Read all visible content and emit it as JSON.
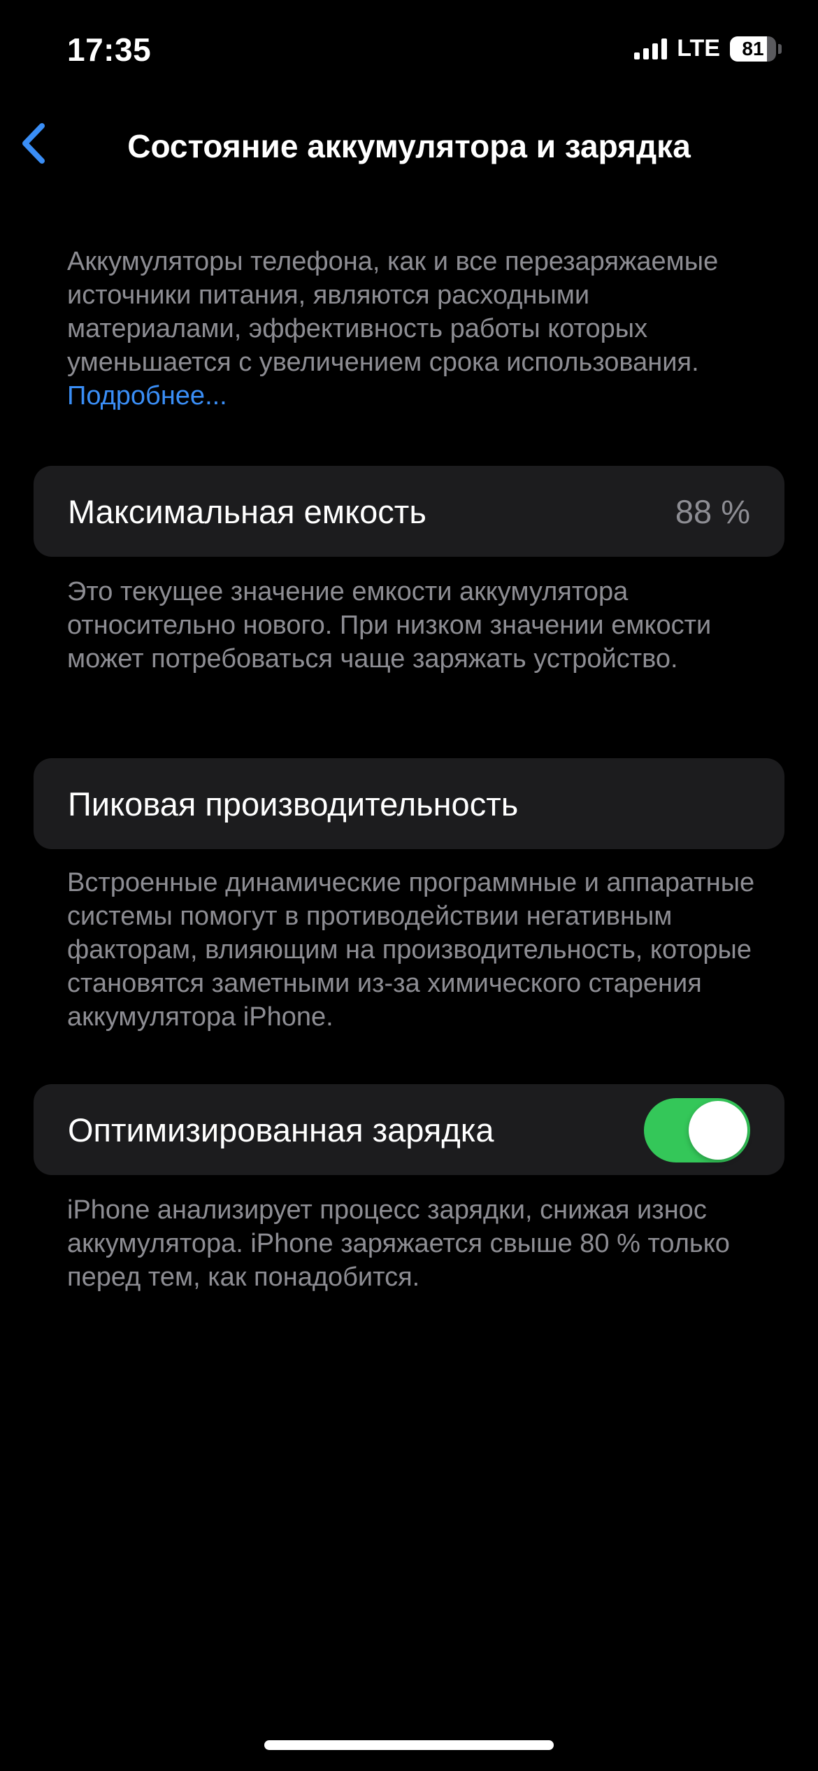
{
  "status_bar": {
    "time": "17:35",
    "network": "LTE",
    "battery_percent": "81",
    "battery_level": 0.81
  },
  "nav": {
    "back_icon": "chevron-left-icon",
    "title": "Состояние аккумулятора и зарядка"
  },
  "intro": {
    "text": "Аккумуляторы телефона, как и все перезаряжаемые источники питания, являются расходными материалами, эффективность работы которых уменьшается с увеличением срока использования.",
    "link": "Подробнее..."
  },
  "max_capacity": {
    "label": "Максимальная емкость",
    "value": "88 %",
    "footer": "Это текущее значение емкости аккумулятора относительно нового. При низком значении емкости может потребоваться чаще заряжать устройство."
  },
  "peak_performance": {
    "label": "Пиковая производительность",
    "footer": "Встроенные динамические программные и аппаратные системы помогут в противодействии негативным факторам, влияющим на производительность, которые становятся заметными из-за химического старения аккумулятора iPhone."
  },
  "optimized_charging": {
    "label": "Оптимизированная зарядка",
    "enabled": true,
    "footer": "iPhone анализирует процесс зарядки, снижая износ аккумулятора. iPhone заряжается свыше 80 % только перед тем, как понадобится."
  },
  "colors": {
    "background": "#000000",
    "card": "#1c1c1e",
    "secondary_text": "#8d8d93",
    "accent_blue": "#3a8ef6",
    "toggle_on": "#34c759"
  }
}
